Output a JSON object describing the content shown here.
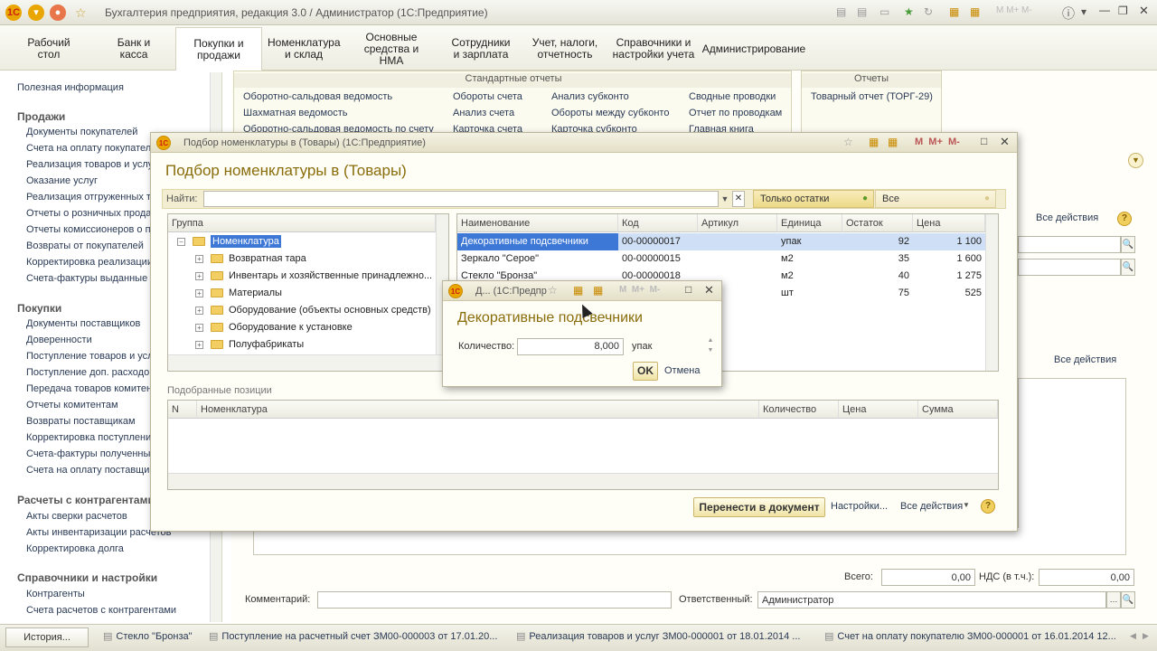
{
  "app": {
    "title": "Бухгалтерия предприятия, редакция 3.0 / Администратор  (1С:Предприятие)"
  },
  "sections": [
    {
      "label": "Рабочий стол"
    },
    {
      "label": "Банк и касса"
    },
    {
      "label": "Покупки и продажи"
    },
    {
      "label": "Номенклатура и склад"
    },
    {
      "label": "Основные средства и НМА"
    },
    {
      "label": "Сотрудники и зарплата"
    },
    {
      "label": "Учет, налоги, отчетность"
    },
    {
      "label": "Справочники и настройки учета"
    },
    {
      "label": "Администрирование"
    }
  ],
  "left_panel": {
    "top_link": "Полезная информация",
    "groups": [
      {
        "title": "Продажи",
        "items": [
          "Документы покупателей",
          "Счета на оплату покупателям",
          "Реализация товаров и услуг",
          "Оказание услуг",
          "Реализация отгруженных товаров",
          "Отчеты о розничных продажах",
          "Отчеты комиссионеров о продажах",
          "Возвраты от покупателей",
          "Корректировка реализации",
          "Счета-фактуры выданные"
        ]
      },
      {
        "title": "Покупки",
        "items": [
          "Документы поставщиков",
          "Доверенности",
          "Поступление товаров и услуг",
          "Поступление доп. расходов",
          "Передача товаров комитенту",
          "Отчеты комитентам",
          "Возвраты поставщикам",
          "Корректировка поступления",
          "Счета-фактуры полученные",
          "Счета на оплату поставщиков"
        ]
      },
      {
        "title": "Расчеты с контрагентами",
        "items": [
          "Акты сверки расчетов",
          "Акты инвентаризации расчетов",
          "Корректировка долга"
        ]
      },
      {
        "title": "Справочники и настройки",
        "items": [
          "Контрагенты",
          "Счета расчетов с контрагентами"
        ]
      }
    ]
  },
  "reports_panel": {
    "standard_title": "Стандартные отчеты",
    "col1": [
      "Оборотно-сальдовая ведомость",
      "Шахматная ведомость",
      "Оборотно-сальдовая ведомость по счету"
    ],
    "col2": [
      "Обороты счета",
      "Анализ счета",
      "Карточка счета"
    ],
    "col3": [
      "Анализ субконто",
      "Обороты между субконто",
      "Карточка субконто"
    ],
    "col4": [
      "Сводные проводки",
      "Отчет по проводкам",
      "Главная книга"
    ],
    "reports_title": "Отчеты",
    "reports": [
      "Товарный отчет (ТОРГ-29)"
    ]
  },
  "doc_form": {
    "all_actions": "Все действия",
    "all_actions2": "Все действия",
    "total_label": "Всего:",
    "total_value": "0,00",
    "vat_label": "НДС (в т.ч.):",
    "vat_value": "0,00",
    "comment_label": "Комментарий:",
    "comment_value": "",
    "responsible_label": "Ответственный:",
    "responsible_value": "Администратор"
  },
  "pick_dialog": {
    "window_title": "Подбор номенклатуры в  (Товары)  (1С:Предприятие)",
    "heading": "Подбор номенклатуры в  (Товары)",
    "find_label": "Найти:",
    "find_value": "",
    "only_stock_label": "Только остатки",
    "all_label": "Все",
    "group_header": "Группа",
    "tree": [
      {
        "label": "Номенклатура",
        "selected": true,
        "root": true
      },
      {
        "label": "Возвратная тара"
      },
      {
        "label": "Инвентарь и хозяйственные принадлежно..."
      },
      {
        "label": "Материалы"
      },
      {
        "label": "Оборудование (объекты основных средств)"
      },
      {
        "label": "Оборудование к установке"
      },
      {
        "label": "Полуфабрикаты"
      }
    ],
    "items_columns": [
      "Наименование",
      "Код",
      "Артикул",
      "Единица",
      "Остаток",
      "Цена"
    ],
    "items": [
      {
        "name": "Декоративные подсвечники",
        "code": "00-00000017",
        "article": "",
        "unit": "упак",
        "stock": "92",
        "price": "1 100"
      },
      {
        "name": "Зеркало \"Серое\"",
        "code": "00-00000015",
        "article": "",
        "unit": "м2",
        "stock": "35",
        "price": "1 600"
      },
      {
        "name": "Стекло \"Бронза\"",
        "code": "00-00000018",
        "article": "",
        "unit": "м2",
        "stock": "40",
        "price": "1 275"
      },
      {
        "name": "",
        "code": "",
        "article": "",
        "unit": "шт",
        "stock": "75",
        "price": "525"
      }
    ],
    "selected_title": "Подобранные позиции",
    "selected_columns": [
      "N",
      "Номенклатура",
      "Количество",
      "Цена",
      "Сумма"
    ],
    "transfer_button": "Перенести в документ",
    "settings_label": "Настройки...",
    "all_actions": "Все действия",
    "help": "?"
  },
  "qty_dialog": {
    "window_title": "Д...  (1С:Предпр",
    "heading": "Декоративные подсвечники",
    "qty_label": "Количество:",
    "qty_value": "8,000",
    "unit": "упак",
    "ok": "OK",
    "cancel": "Отмена"
  },
  "taskbar": {
    "history": "История...",
    "items": [
      "Стекло \"Бронза\"",
      "Поступление на расчетный счет ЗМ00-000003 от 17.01.20...",
      "Реализация товаров и услуг ЗМ00-000001 от 18.01.2014 ...",
      "Счет на оплату покупателю ЗМ00-000001 от 16.01.2014 12..."
    ]
  },
  "colors": {
    "accent_yellow": "#f0e3a6",
    "selection_blue": "#cfe0f6",
    "heading_gold": "#8a6d0b"
  }
}
